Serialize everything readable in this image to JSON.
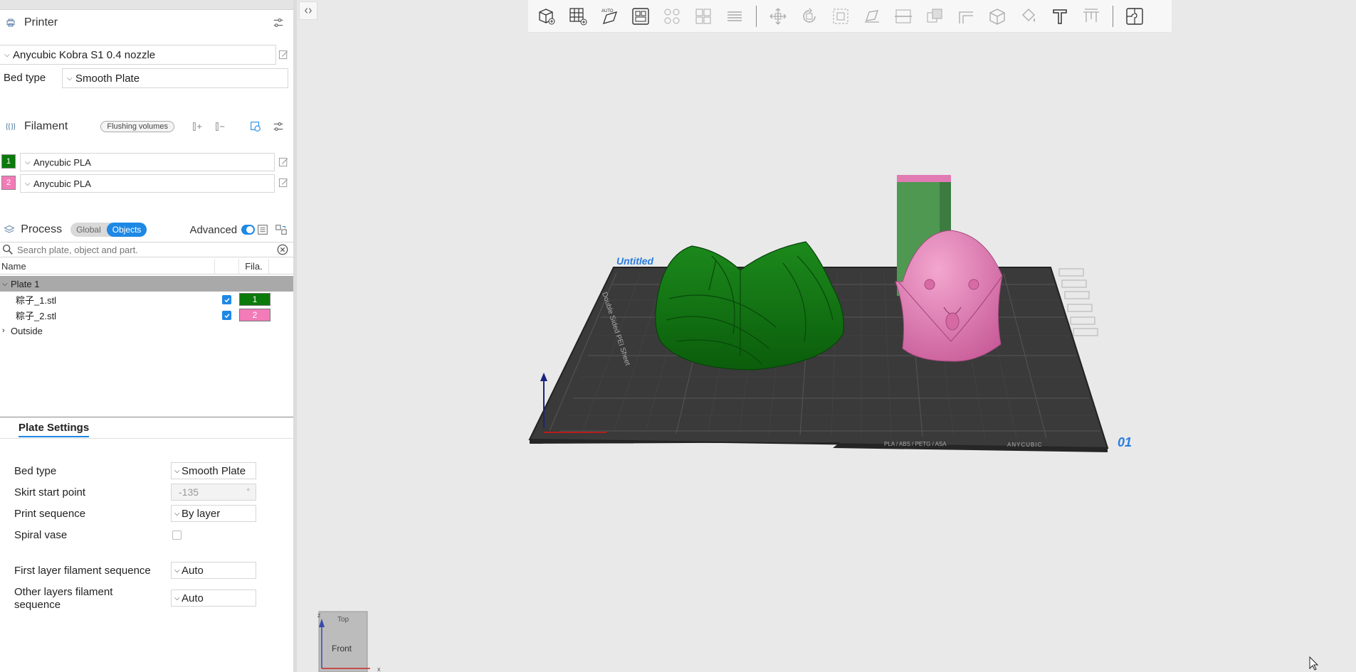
{
  "printer": {
    "title": "Printer",
    "preset": "Anycubic Kobra S1 0.4 nozzle",
    "bed_type_label": "Bed type",
    "bed_type_value": "Smooth Plate"
  },
  "filament": {
    "title": "Filament",
    "flushing_label": "Flushing volumes",
    "items": [
      {
        "index": "1",
        "color": "#0a7a0a",
        "name": "Anycubic PLA"
      },
      {
        "index": "2",
        "color": "#f27bb8",
        "name": "Anycubic PLA"
      }
    ]
  },
  "process": {
    "title": "Process",
    "tab_global": "Global",
    "tab_objects": "Objects",
    "advanced_label": "Advanced"
  },
  "search": {
    "placeholder": "Search plate, object and part."
  },
  "object_list": {
    "col_name": "Name",
    "col_fila": "Fila.",
    "plate": "Plate 1",
    "objects": [
      {
        "name": "粽子_1.stl",
        "fila": "1",
        "color": "#0a7a0a"
      },
      {
        "name": "粽子_2.stl",
        "fila": "2",
        "color": "#f27bb8"
      }
    ],
    "outside": "Outside"
  },
  "plate_settings": {
    "tab": "Plate Settings",
    "bed_type_label": "Bed type",
    "bed_type_value": "Smooth Plate",
    "skirt_label": "Skirt start point",
    "skirt_value": "-135",
    "skirt_unit": "°",
    "print_seq_label": "Print sequence",
    "print_seq_value": "By layer",
    "spiral_label": "Spiral vase",
    "first_layer_label": "First layer filament sequence",
    "first_layer_value": "Auto",
    "other_layers_label": "Other layers filament sequence",
    "other_layers_value": "Auto"
  },
  "viewport": {
    "plate_name": "Untitled",
    "plate_number": "01",
    "bed_brand": "ANYCUBIC",
    "bed_materials": "PLA / ABS / PETG / ASA",
    "bed_side_text": "Double Sided PEI Sheet",
    "navcube_top": "Top",
    "navcube_front": "Front",
    "axis_x": "x",
    "axis_z": "z"
  },
  "colors": {
    "accent": "#1e88e5",
    "green_object": "#0f7a14",
    "pink_object": "#e27ab4",
    "bed": "#3a3a3a"
  }
}
